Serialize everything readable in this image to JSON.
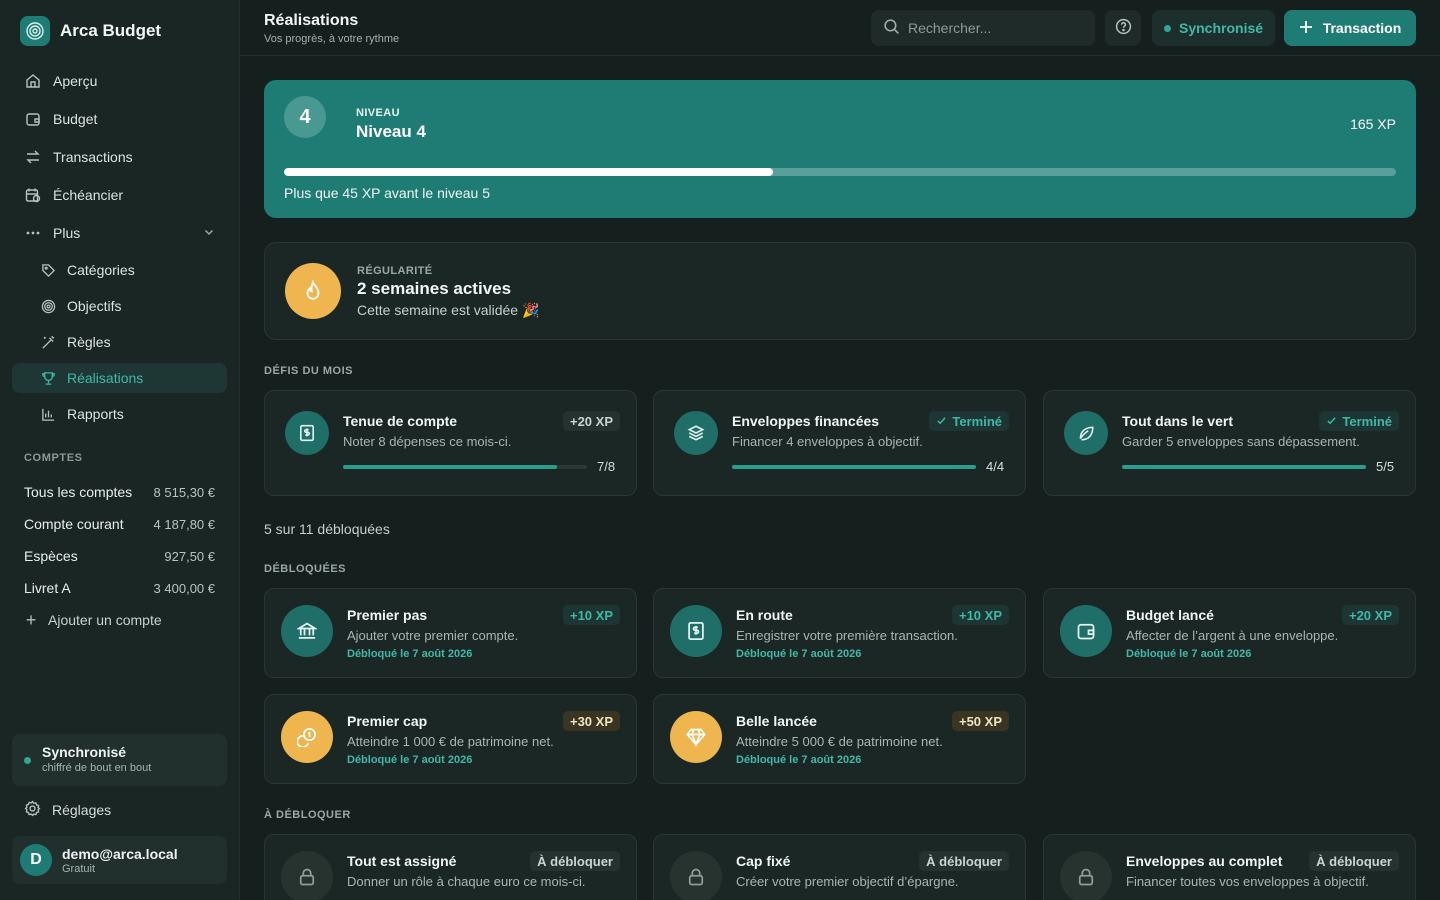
{
  "app": {
    "name": "Arca Budget"
  },
  "sidebar": {
    "nav": [
      {
        "label": "Aperçu",
        "icon": "home-icon"
      },
      {
        "label": "Budget",
        "icon": "wallet-icon"
      },
      {
        "label": "Transactions",
        "icon": "swap-icon"
      },
      {
        "label": "Échéancier",
        "icon": "calendar-clock-icon"
      },
      {
        "label": "Plus",
        "icon": "more-icon"
      }
    ],
    "sub": [
      {
        "label": "Catégories",
        "icon": "tag-icon"
      },
      {
        "label": "Objectifs",
        "icon": "target-icon"
      },
      {
        "label": "Règles",
        "icon": "magic-wand-icon"
      },
      {
        "label": "Réalisations",
        "icon": "trophy-icon",
        "active": true
      },
      {
        "label": "Rapports",
        "icon": "bar-chart-icon"
      }
    ],
    "accounts_label": "COMPTES",
    "accounts": [
      {
        "name": "Tous les comptes",
        "amount": "8 515,30 €"
      },
      {
        "name": "Compte courant",
        "amount": "4 187,80 €"
      },
      {
        "name": "Espèces",
        "amount": "927,50 €"
      },
      {
        "name": "Livret A",
        "amount": "3 400,00 €"
      }
    ],
    "add_account": "Ajouter un compte",
    "sync": {
      "title": "Synchronisé",
      "subtitle": "chiffré de bout en bout"
    },
    "settings": "Réglages",
    "user": {
      "initial": "D",
      "email": "demo@arca.local",
      "plan": "Gratuit"
    }
  },
  "header": {
    "title": "Réalisations",
    "subtitle": "Vos progrès, à votre rythme",
    "search_placeholder": "Rechercher...",
    "sync_label": "Synchronisé",
    "transaction_label": "Transaction"
  },
  "level": {
    "badge": "4",
    "kicker": "NIVEAU",
    "title": "Niveau 4",
    "xp": "165 XP",
    "progress": 0.44,
    "note": "Plus que 45 XP avant le niveau 5"
  },
  "streak": {
    "kicker": "RÉGULARITÉ",
    "title": "2 semaines actives",
    "subtitle": "Cette semaine est validée 🎉"
  },
  "challenges": {
    "label": "DÉFIS DU MOIS",
    "items": [
      {
        "title": "Tenue de compte",
        "desc": "Noter 8 dépenses ce mois-ci.",
        "badge": "+20 XP",
        "badge_type": "xp-plain",
        "count": "7/8",
        "progress": 0.875,
        "icon": "receipt-icon"
      },
      {
        "title": "Enveloppes financées",
        "desc": "Financer 4 enveloppes à objectif.",
        "badge": "Terminé",
        "badge_type": "done",
        "count": "4/4",
        "progress": 1.0,
        "icon": "layers-icon"
      },
      {
        "title": "Tout dans le vert",
        "desc": "Garder 5 enveloppes sans dépassement.",
        "badge": "Terminé",
        "badge_type": "done",
        "count": "5/5",
        "progress": 1.0,
        "icon": "leaf-icon"
      }
    ]
  },
  "unlocked_count": "5 sur 11 débloquées",
  "unlocked": {
    "label": "DÉBLOQUÉES",
    "items": [
      {
        "title": "Premier pas",
        "desc": "Ajouter votre premier compte.",
        "badge": "+10 XP",
        "badge_type": "xp",
        "date": "Débloqué le 7 août 2026",
        "icon": "bank-icon",
        "color": "teal"
      },
      {
        "title": "En route",
        "desc": "Enregistrer votre première transaction.",
        "badge": "+10 XP",
        "badge_type": "xp",
        "date": "Débloqué le 7 août 2026",
        "icon": "receipt-icon",
        "color": "teal"
      },
      {
        "title": "Budget lancé",
        "desc": "Affecter de l’argent à une enveloppe.",
        "badge": "+20 XP",
        "badge_type": "xp",
        "date": "Débloqué le 7 août 2026",
        "icon": "wallet-icon",
        "color": "teal"
      },
      {
        "title": "Premier cap",
        "desc": "Atteindre 1 000 € de patrimoine net.",
        "badge": "+30 XP",
        "badge_type": "xp-gold",
        "date": "Débloqué le 7 août 2026",
        "icon": "coins-icon",
        "color": "gold"
      },
      {
        "title": "Belle lancée",
        "desc": "Atteindre 5 000 € de patrimoine net.",
        "badge": "+50 XP",
        "badge_type": "xp-gold",
        "date": "Débloqué le 7 août 2026",
        "icon": "diamond-icon",
        "color": "gold"
      }
    ]
  },
  "locked": {
    "label": "À DÉBLOQUER",
    "items": [
      {
        "title": "Tout est assigné",
        "desc": "Donner un rôle à chaque euro ce mois-ci.",
        "badge": "À débloquer"
      },
      {
        "title": "Cap fixé",
        "desc": "Créer votre premier objectif d’épargne.",
        "badge": "À débloquer"
      },
      {
        "title": "Enveloppes au complet",
        "desc": "Financer toutes vos enveloppes à objectif.",
        "badge": "À débloquer"
      }
    ]
  },
  "colors": {
    "accent": "#1f7c74",
    "accent_text": "#3fb8a9",
    "gold": "#efb54e",
    "background": "#15201e"
  }
}
